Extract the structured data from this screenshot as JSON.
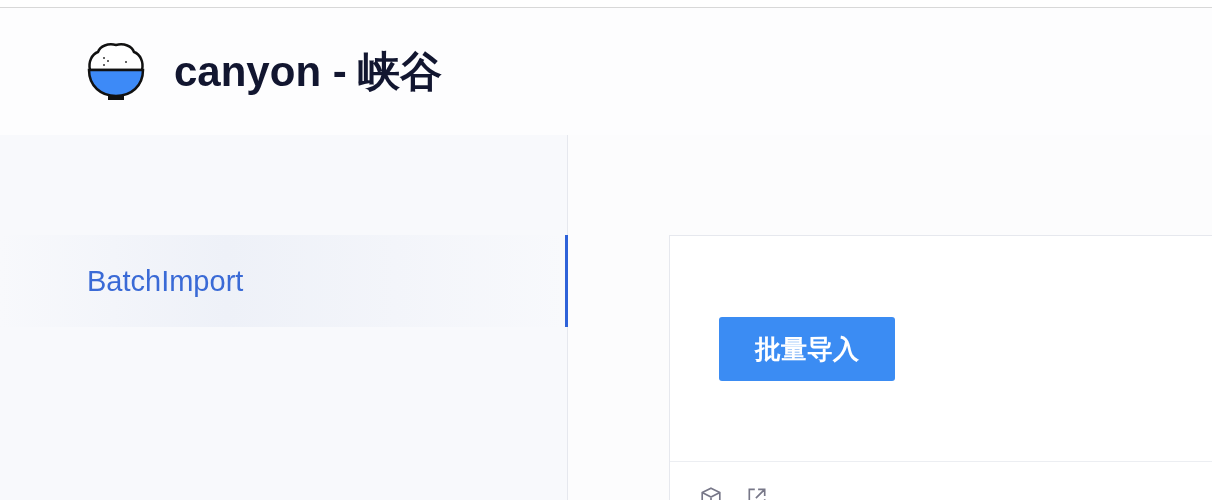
{
  "header": {
    "title": "canyon - 峡谷"
  },
  "sidebar": {
    "items": [
      {
        "label": "BatchImport",
        "selected": true
      }
    ]
  },
  "card": {
    "button": "批量导入"
  }
}
